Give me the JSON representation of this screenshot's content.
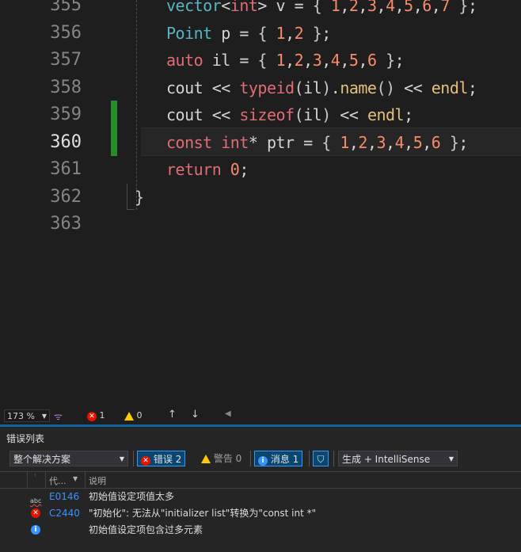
{
  "editor": {
    "lines": [
      {
        "num": "355",
        "tokens": [
          [
            "ty",
            "vector"
          ],
          [
            "op",
            "<"
          ],
          [
            "kw",
            "int"
          ],
          [
            "op",
            "> "
          ],
          [
            "op",
            "v = "
          ],
          [
            "br",
            "{ "
          ],
          [
            "num",
            "1"
          ],
          [
            "op",
            ","
          ],
          [
            "num",
            "2"
          ],
          [
            "op",
            ","
          ],
          [
            "num",
            "3"
          ],
          [
            "op",
            ","
          ],
          [
            "num",
            "4"
          ],
          [
            "op",
            ","
          ],
          [
            "num",
            "5"
          ],
          [
            "op",
            ","
          ],
          [
            "num",
            "6"
          ],
          [
            "op",
            ","
          ],
          [
            "num",
            "7"
          ],
          [
            "br",
            " }"
          ],
          [
            "op",
            ";"
          ]
        ]
      },
      {
        "num": "356",
        "tokens": [
          [
            "ty",
            "Point"
          ],
          [
            "op",
            " p = "
          ],
          [
            "br",
            "{ "
          ],
          [
            "num",
            "1"
          ],
          [
            "op",
            ","
          ],
          [
            "num",
            "2"
          ],
          [
            "br",
            " }"
          ],
          [
            "op",
            ";"
          ]
        ]
      },
      {
        "num": "357",
        "tokens": [
          [
            "kw",
            "auto"
          ],
          [
            "op",
            " il = "
          ],
          [
            "br",
            "{ "
          ],
          [
            "num",
            "1"
          ],
          [
            "op",
            ","
          ],
          [
            "num",
            "2"
          ],
          [
            "op",
            ","
          ],
          [
            "num",
            "3"
          ],
          [
            "op",
            ","
          ],
          [
            "num",
            "4"
          ],
          [
            "op",
            ","
          ],
          [
            "num",
            "5"
          ],
          [
            "op",
            ","
          ],
          [
            "num",
            "6"
          ],
          [
            "br",
            " }"
          ],
          [
            "op",
            ";"
          ]
        ]
      },
      {
        "num": "358",
        "tokens": [
          [
            "op",
            "cout << "
          ],
          [
            "kw",
            "typeid"
          ],
          [
            "br",
            "("
          ],
          [
            "op",
            "il"
          ],
          [
            "br",
            ")"
          ],
          [
            "op",
            "."
          ],
          [
            "fn",
            "name"
          ],
          [
            "br",
            "()"
          ],
          [
            "op",
            " << "
          ],
          [
            "fn",
            "endl"
          ],
          [
            "op",
            ";"
          ]
        ]
      },
      {
        "num": "359",
        "tokens": [
          [
            "op",
            "cout << "
          ],
          [
            "kw",
            "sizeof"
          ],
          [
            "br",
            "("
          ],
          [
            "op",
            "il"
          ],
          [
            "br",
            ")"
          ],
          [
            "op",
            " << "
          ],
          [
            "fn",
            "endl"
          ],
          [
            "op",
            ";"
          ]
        ]
      },
      {
        "num": "360",
        "tokens": [
          [
            "kw",
            "const"
          ],
          [
            "op",
            " "
          ],
          [
            "kw",
            "int"
          ],
          [
            "op",
            "* ptr = "
          ],
          [
            "br",
            "{ "
          ],
          [
            "num",
            "1"
          ],
          [
            "op",
            ","
          ],
          [
            "num",
            "2"
          ],
          [
            "op",
            ","
          ],
          [
            "num",
            "3"
          ],
          [
            "op",
            ","
          ],
          [
            "num",
            "4"
          ],
          [
            "op",
            ","
          ],
          [
            "num",
            "5"
          ],
          [
            "op",
            ","
          ],
          [
            "num",
            "6"
          ],
          [
            "br",
            " }"
          ],
          [
            "op",
            ";"
          ]
        ]
      },
      {
        "num": "361",
        "tokens": [
          [
            "kw",
            "return"
          ],
          [
            "op",
            " "
          ],
          [
            "num",
            "0"
          ],
          [
            "op",
            ";"
          ]
        ]
      },
      {
        "num": "362",
        "tokens": [
          [
            "br",
            "}"
          ]
        ]
      },
      {
        "num": "363",
        "tokens": []
      }
    ],
    "active_line": "360"
  },
  "status": {
    "zoom": "173 %",
    "errors": "1",
    "warnings": "0"
  },
  "panel": {
    "title": "错误列表",
    "scope": "整个解决方案",
    "errors_label": "错误 2",
    "warnings_label": "警告 0",
    "messages_label": "消息 1",
    "build_filter": "生成 + IntelliSense",
    "col_code": "代...",
    "col_desc": "说明",
    "rows": [
      {
        "icon": "spellcheck-icon",
        "code": "E0146",
        "desc": "初始值设定项值太多"
      },
      {
        "icon": "error-icon",
        "code": "C2440",
        "desc": "\"初始化\": 无法从\"initializer list\"转换为\"const int *\""
      },
      {
        "icon": "info-icon",
        "code": "",
        "desc": "初始值设定项包含过多元素"
      }
    ]
  }
}
